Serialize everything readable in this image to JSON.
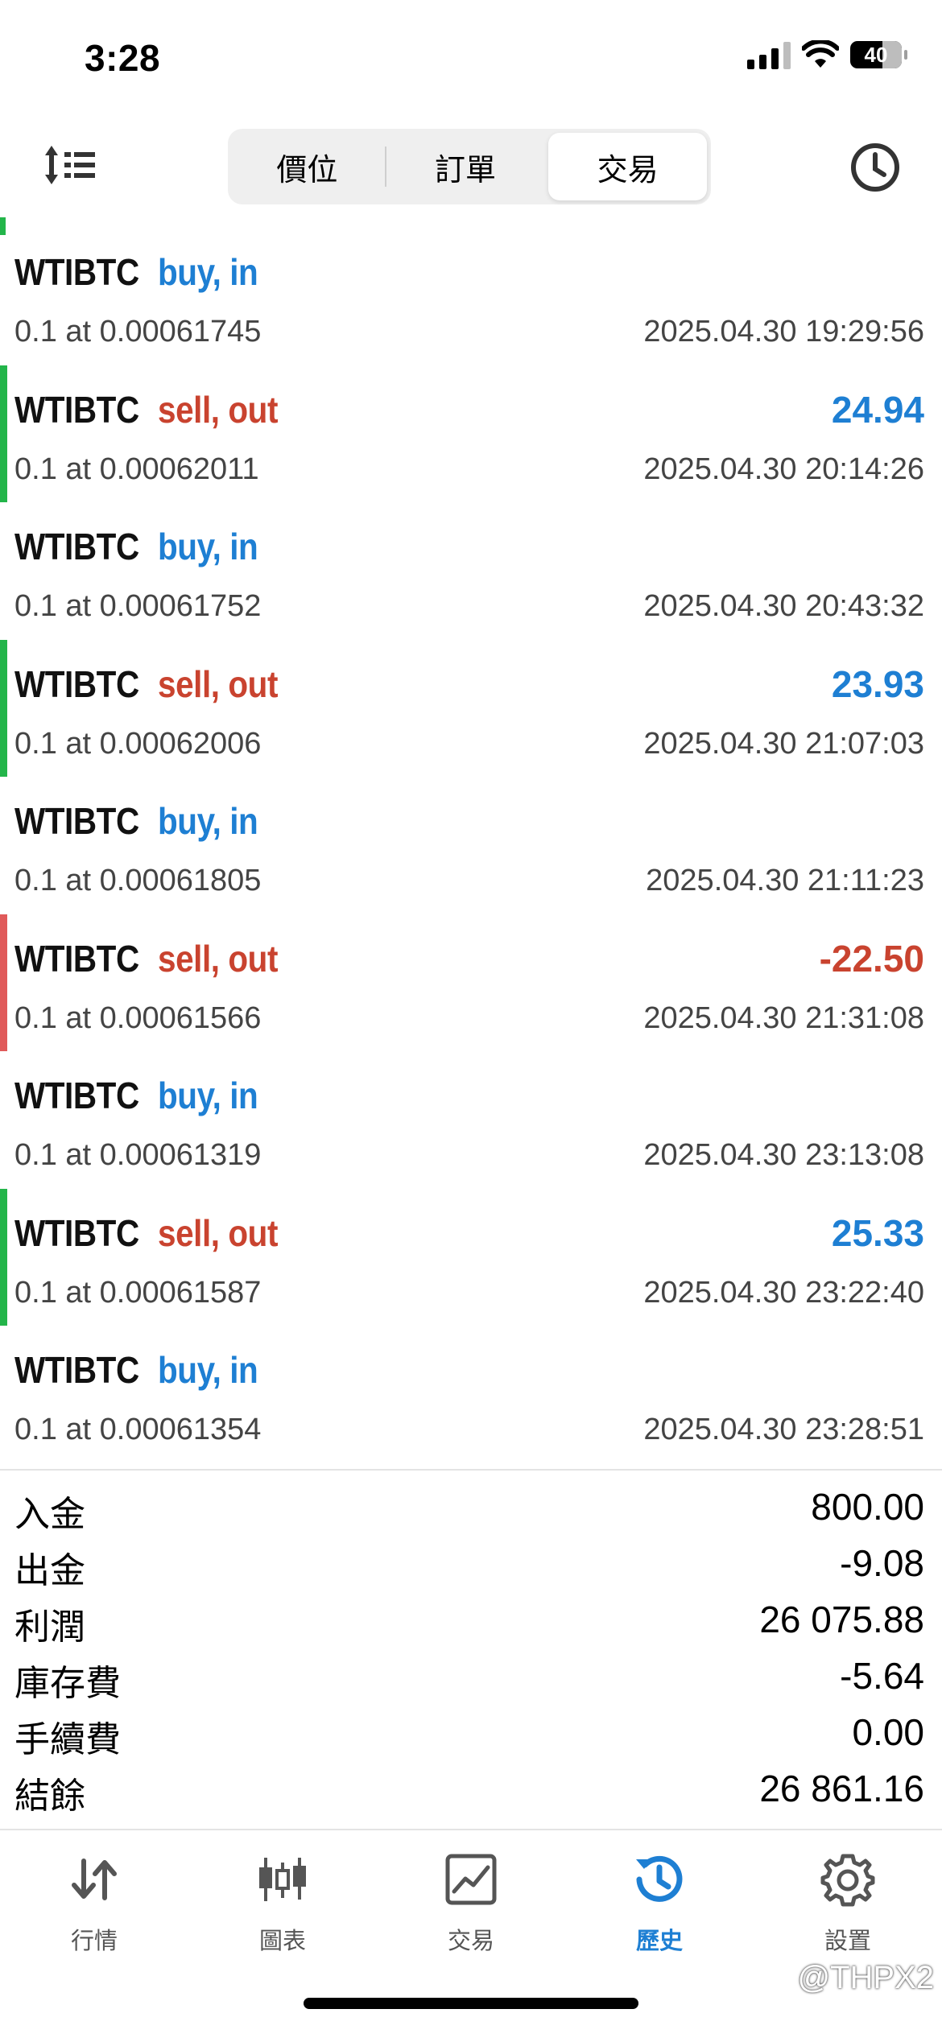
{
  "status_bar": {
    "time": "3:28",
    "battery": "40"
  },
  "segmented": {
    "tabs": [
      "價位",
      "訂單",
      "交易"
    ],
    "active_index": 2
  },
  "deals": [
    {
      "symbol": "WTIBTC",
      "type": "buy, in",
      "side": "buy",
      "detail": "0.1 at 0.00061745",
      "datetime": "2025.04.30 19:29:56",
      "profit": "",
      "bar": ""
    },
    {
      "symbol": "WTIBTC",
      "type": "sell, out",
      "side": "sell",
      "detail": "0.1 at 0.00062011",
      "datetime": "2025.04.30 20:14:26",
      "profit": "24.94",
      "bar": "#23b54a"
    },
    {
      "symbol": "WTIBTC",
      "type": "buy, in",
      "side": "buy",
      "detail": "0.1 at 0.00061752",
      "datetime": "2025.04.30 20:43:32",
      "profit": "",
      "bar": ""
    },
    {
      "symbol": "WTIBTC",
      "type": "sell, out",
      "side": "sell",
      "detail": "0.1 at 0.00062006",
      "datetime": "2025.04.30 21:07:03",
      "profit": "23.93",
      "bar": "#23b54a"
    },
    {
      "symbol": "WTIBTC",
      "type": "buy, in",
      "side": "buy",
      "detail": "0.1 at 0.00061805",
      "datetime": "2025.04.30 21:11:23",
      "profit": "",
      "bar": ""
    },
    {
      "symbol": "WTIBTC",
      "type": "sell, out",
      "side": "sell",
      "detail": "0.1 at 0.00061566",
      "datetime": "2025.04.30 21:31:08",
      "profit": "-22.50",
      "bar": "#e05a5a"
    },
    {
      "symbol": "WTIBTC",
      "type": "buy, in",
      "side": "buy",
      "detail": "0.1 at 0.00061319",
      "datetime": "2025.04.30 23:13:08",
      "profit": "",
      "bar": ""
    },
    {
      "symbol": "WTIBTC",
      "type": "sell, out",
      "side": "sell",
      "detail": "0.1 at 0.00061587",
      "datetime": "2025.04.30 23:22:40",
      "profit": "25.33",
      "bar": "#23b54a"
    },
    {
      "symbol": "WTIBTC",
      "type": "buy, in",
      "side": "buy",
      "detail": "0.1 at 0.00061354",
      "datetime": "2025.04.30 23:28:51",
      "profit": "",
      "bar": ""
    }
  ],
  "summary": [
    {
      "label": "入金",
      "value": "800.00"
    },
    {
      "label": "出金",
      "value": "-9.08"
    },
    {
      "label": "利潤",
      "value": "26 075.88"
    },
    {
      "label": "庫存費",
      "value": "-5.64"
    },
    {
      "label": "手續費",
      "value": "0.00"
    },
    {
      "label": "結餘",
      "value": "26 861.16"
    }
  ],
  "nav": {
    "items": [
      {
        "label": "行情",
        "icon": "quotes-icon"
      },
      {
        "label": "圖表",
        "icon": "candlestick-chart-icon"
      },
      {
        "label": "交易",
        "icon": "trade-chart-icon"
      },
      {
        "label": "歷史",
        "icon": "history-icon"
      },
      {
        "label": "設置",
        "icon": "gear-icon"
      }
    ],
    "active_index": 3
  },
  "watermark": "@THPX2",
  "colors": {
    "buy": "#1e7fd3",
    "sell": "#c9432f",
    "profit_positive": "#1e7fd3",
    "profit_negative": "#c9432f",
    "win_bar": "#23b54a",
    "loss_bar": "#e05a5a"
  }
}
